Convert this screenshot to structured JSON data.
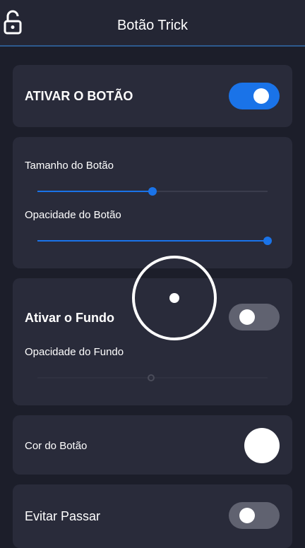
{
  "header": {
    "title": "Botão Trick",
    "lock_icon": "unlocked-padlock-icon"
  },
  "enable_button": {
    "label": "ATIVAR O BOTÃO",
    "toggled": true
  },
  "size_opacity": {
    "size_label": "Tamanho do Botão",
    "size_value": 0.5,
    "opacity_label": "Opacidade do Botão",
    "opacity_value": 1.0
  },
  "background": {
    "label": "Ativar o Fundo",
    "toggled": false,
    "opacity_label": "Opacidade do Fundo",
    "opacity_value": 0.5
  },
  "button_color": {
    "label": "Cor do Botão",
    "color": "#ffffff"
  },
  "avoid_passing": {
    "label": "Evitar Passar",
    "toggled": false
  },
  "colors": {
    "accent": "#1a73e8",
    "background": "#1c1e2a",
    "card": "#292b3a",
    "toggle_off": "#606270"
  }
}
